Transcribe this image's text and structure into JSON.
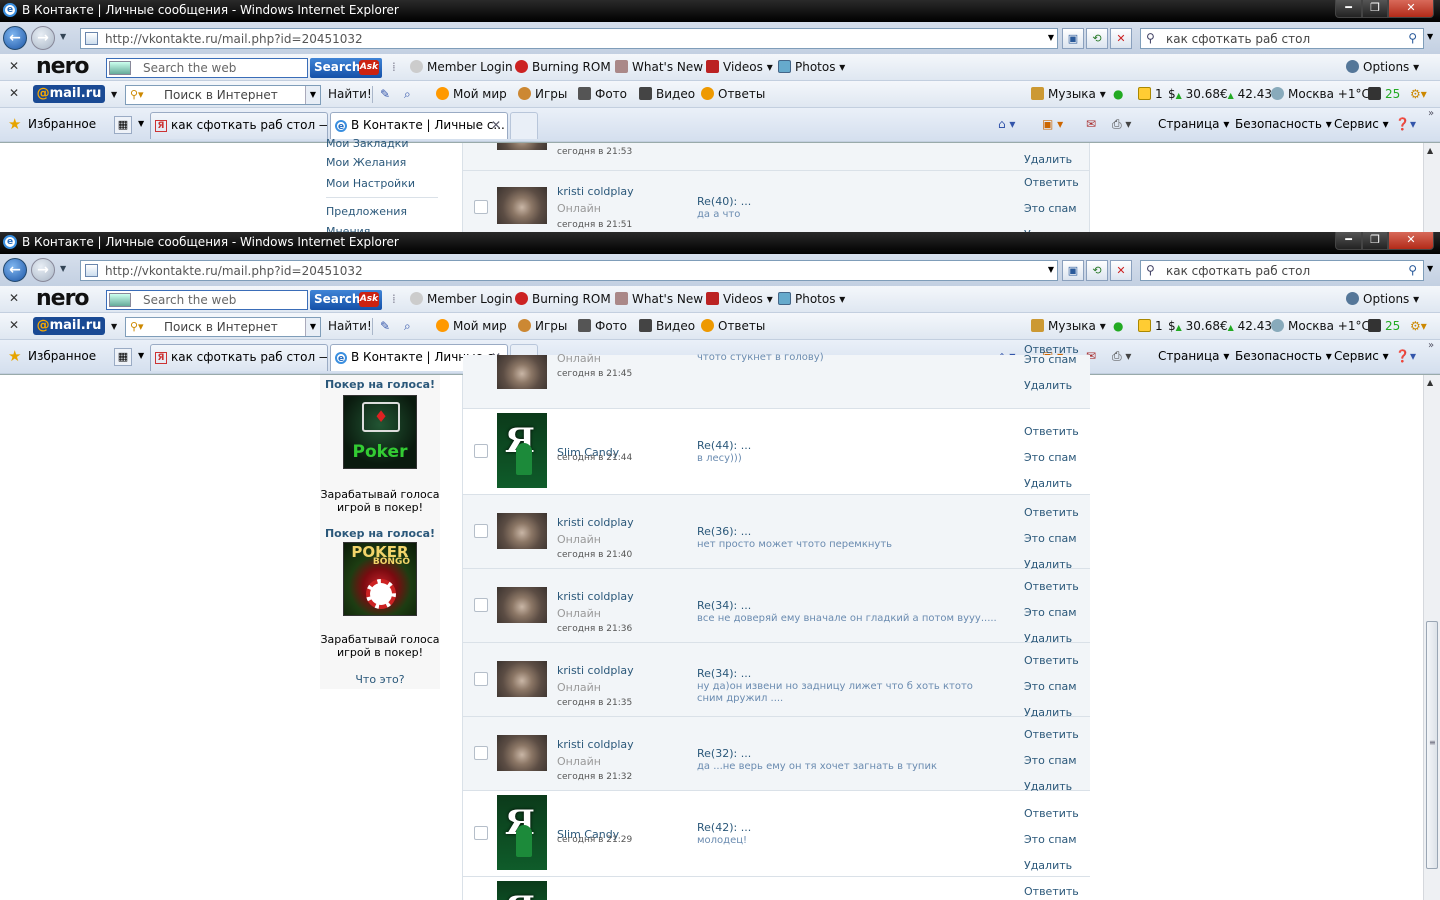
{
  "window": {
    "title": "В Контакте | Личные сообщения - Windows Internet Explorer",
    "url": "http://vkontakte.ru/mail.php?id=20451032",
    "search_value": "как сфоткать раб стол"
  },
  "nero_toolbar": {
    "logo": "nero",
    "search_placeholder": "Search the web",
    "search_button": "Search",
    "ask_label": "Ask",
    "items": [
      "Member Login",
      "Burning ROM",
      "What's New",
      "Videos",
      "Photos"
    ],
    "options": "Options"
  },
  "mail_toolbar": {
    "logo_at": "@",
    "logo_text": "mail.ru",
    "search_placeholder": "Поиск в Интернет",
    "find_button": "Найти!",
    "items": [
      "Мой мир",
      "Игры",
      "Фото",
      "Видео",
      "Ответы"
    ],
    "music": "Музыка",
    "mail_count": "1",
    "usd_symbol": "$",
    "usd": "30.68",
    "eur_symbol": "€",
    "eur": "42.43",
    "weather": "Москва +1°C",
    "traffic": "25"
  },
  "fav_bar": {
    "favorites": "Избранное",
    "tabs": [
      "как сфоткать раб стол — ...",
      "В Контакте | Личные с..."
    ],
    "commands": [
      "Страница",
      "Безопасность",
      "Сервис"
    ]
  },
  "vk": {
    "sidebar_links": [
      "Мои Закладки",
      "Мои Желания",
      "Мои Настройки",
      "Предложения",
      "Мнения"
    ],
    "ads": [
      {
        "title": "Покер на голоса!",
        "image_text": "Poker",
        "caption": "Зарабатывай голоса игрой в покер!"
      },
      {
        "title": "Покер на голоса!",
        "image_text": "POKER",
        "image_sub": "BONGO",
        "caption": "Зарабатывай голоса игрой в покер!"
      }
    ],
    "what_is_this": "Что это?",
    "actions": {
      "reply": "Ответить",
      "spam": "Это спам",
      "delete": "Удалить"
    },
    "top_messages": [
      {
        "time": "сегодня в 21:53"
      },
      {
        "name": "kristi coldplay",
        "online": "Онлайн",
        "time": "сегодня в 21:51",
        "subject": "Re(40): ...",
        "body": "да а что"
      }
    ],
    "messages": [
      {
        "name": "",
        "online": "Онлайн",
        "time": "сегодня в 21:45",
        "subject": "",
        "body": "чтото стукнет в голову)"
      },
      {
        "name": "Slim Candy",
        "online": "",
        "time": "сегодня в 21:44",
        "subject": "Re(44): ...",
        "body": "в лесу)))"
      },
      {
        "name": "kristi coldplay",
        "online": "Онлайн",
        "time": "сегодня в 21:40",
        "subject": "Re(36): ...",
        "body": "нет просто может чтото перемкнуть"
      },
      {
        "name": "kristi coldplay",
        "online": "Онлайн",
        "time": "сегодня в 21:36",
        "subject": "Re(34): ...",
        "body": "все не доверяй ему вначале он гладкий а потом вууу....."
      },
      {
        "name": "kristi coldplay",
        "online": "Онлайн",
        "time": "сегодня в 21:35",
        "subject": "Re(34): ...",
        "body": "ну да)он извени но задницу лижет что б хоть ктото сним дружил ...."
      },
      {
        "name": "kristi coldplay",
        "online": "Онлайн",
        "time": "сегодня в 21:32",
        "subject": "Re(32): ...",
        "body": "да ...не верь ему он тя хочет загнать в тупик"
      },
      {
        "name": "Slim Candy",
        "online": "",
        "time": "сегодня в 21:29",
        "subject": "Re(42): ...",
        "body": "молодец!"
      }
    ]
  }
}
